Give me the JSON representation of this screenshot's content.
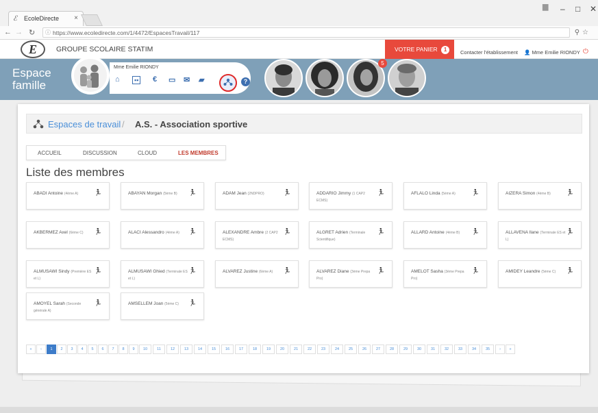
{
  "browser": {
    "tab_title": "EcoleDirecte",
    "tab_close": "×",
    "url": "https://www.ecoledirecte.com/1/4472/EspacesTravail/117",
    "minimize": "–",
    "maximize": "□",
    "close": "✕"
  },
  "header": {
    "logo_letter": "E",
    "school_name": "GROUPE SCOLAIRE STATIM",
    "cart_label": "VOTRE PANIER",
    "cart_count": "1",
    "contact_label": "Contacter l'établissement",
    "user_label": "Mme Emilie RIONDY"
  },
  "banner": {
    "title_line1": "Espace",
    "title_line2": "famille",
    "parent_name": "Mme Emilie RIONDY",
    "student_badge": "5"
  },
  "breadcrumb": {
    "link": "Espaces de travail",
    "separator": "/",
    "current": "A.S. - Association sportive"
  },
  "tabs": [
    "ACCUEIL",
    "DISCUSSION",
    "CLOUD",
    "LES MEMBRES"
  ],
  "list_title": "Liste des membres",
  "members": [
    {
      "name": "ABADI Antoine",
      "cls": "(4ème A)"
    },
    {
      "name": "ABAYAN Morgan",
      "cls": "(5ème B)"
    },
    {
      "name": "ADAM Jean",
      "cls": "(2NDPRO)"
    },
    {
      "name": "ADDARIO Jimmy",
      "cls": "(1 CAP2 ECMS)"
    },
    {
      "name": "AFLALO Linda",
      "cls": "(5ème A)"
    },
    {
      "name": "AIZERA Simon",
      "cls": "(4ème B)"
    },
    {
      "name": "AKBERMEZ Axel",
      "cls": "(6ème C)"
    },
    {
      "name": "ALACI Alessandro",
      "cls": "(4ème A)"
    },
    {
      "name": "ALEXANDRE Ambre",
      "cls": "(2 CAP2 ECMS)"
    },
    {
      "name": "ALGRET Adrien",
      "cls": "(Terminale Scientifique)"
    },
    {
      "name": "ALLARD Antoine",
      "cls": "(4ème B)"
    },
    {
      "name": "ALLAVENA Ilane",
      "cls": "(Terminale ES et L)"
    },
    {
      "name": "ALMUSAWI Sindy",
      "cls": "(Première ES et L)"
    },
    {
      "name": "ALMUSAWI Ghied",
      "cls": "(Terminale ES et L)"
    },
    {
      "name": "ALVAREZ Justine",
      "cls": "(6ème A)"
    },
    {
      "name": "ALVAREZ Diane",
      "cls": "(3ème Prepa Pro)"
    },
    {
      "name": "AMELOT Sasha",
      "cls": "(3ème Prepa Pro)"
    },
    {
      "name": "AMIDEY Leandre",
      "cls": "(5ème C)"
    },
    {
      "name": "AMOYEL Sarah",
      "cls": "(Seconde générale A)"
    },
    {
      "name": "AMSELLEM Joan",
      "cls": "(5ème C)"
    }
  ],
  "pagination": {
    "first": "«",
    "prev": "‹",
    "next": "›",
    "last": "»",
    "pages": [
      "1",
      "2",
      "3",
      "4",
      "5",
      "6",
      "7",
      "8",
      "9",
      "10",
      "11",
      "12",
      "13",
      "14",
      "15",
      "16",
      "17",
      "18",
      "19",
      "20",
      "21",
      "22",
      "23",
      "24",
      "25",
      "26",
      "27",
      "28",
      "29",
      "30",
      "31",
      "32",
      "33",
      "34",
      "35"
    ],
    "current": "1"
  },
  "colors": {
    "accent_red": "#e8493c",
    "banner_blue": "#7fa0b8",
    "link_blue": "#4a8fd8",
    "icon_blue": "#3d6fb0"
  },
  "icons": {
    "home": "home-icon",
    "id_card": "id-card-icon",
    "euro": "euro-icon",
    "card": "credit-card-icon",
    "mail": "mail-icon",
    "folder": "folder-icon",
    "workspace": "workspace-icon",
    "help": "help-icon",
    "member": "sport-icon"
  }
}
